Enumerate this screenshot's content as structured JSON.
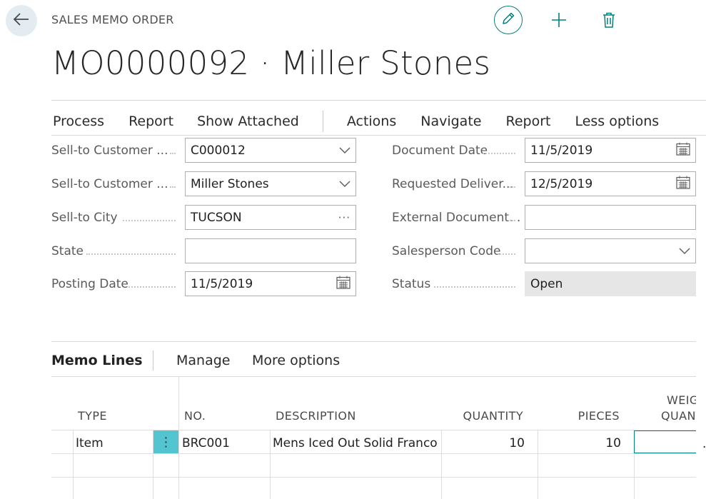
{
  "header": {
    "caption": "SALES MEMO ORDER",
    "title": "MO0000092 · Miller Stones",
    "icons": {
      "back": "arrow-left-icon",
      "edit": "pencil-icon",
      "new": "plus-icon",
      "delete": "trash-icon"
    }
  },
  "actionbar": {
    "items": [
      "Process",
      "Report",
      "Show Attached",
      "Actions",
      "Navigate",
      "Report",
      "Less options"
    ]
  },
  "form": {
    "left": [
      {
        "label": "Sell-to Customer ...",
        "value": "C000012",
        "control": "dropdown"
      },
      {
        "label": "Sell-to Customer ...",
        "value": "Miller Stones",
        "control": "dropdown"
      },
      {
        "label": "Sell-to City",
        "value": "TUCSON",
        "control": "lookup"
      },
      {
        "label": "State",
        "value": "",
        "control": "text"
      },
      {
        "label": "Posting Date",
        "value": "11/5/2019",
        "control": "date"
      }
    ],
    "right": [
      {
        "label": "Document Date",
        "value": "11/5/2019",
        "control": "date"
      },
      {
        "label": "Requested Deliver...",
        "value": "12/5/2019",
        "control": "date"
      },
      {
        "label": "External Document...",
        "value": "",
        "control": "text"
      },
      {
        "label": "Salesperson Code",
        "value": "",
        "control": "dropdown"
      },
      {
        "label": "Status",
        "value": "Open",
        "control": "readonly"
      }
    ],
    "lookup_glyph": "···"
  },
  "lines": {
    "title": "Memo Lines",
    "menu": [
      "Manage",
      "More options"
    ],
    "columns": {
      "type": "TYPE",
      "no": "NO.",
      "description": "DESCRIPTION",
      "quantity": "QUANTITY",
      "pieces": "PIECES",
      "weight_line1": "WEIG",
      "weight_line2": "QUANT"
    },
    "row_menu_glyph": "⋮",
    "rows": [
      {
        "type": "Item",
        "no": "BRC001",
        "description": "Mens Iced Out Solid Franco ...",
        "quantity": "10",
        "pieces": "10",
        "weight": ""
      }
    ],
    "stray_mark": "."
  },
  "colors": {
    "accent": "#00807a",
    "row_selected": "#52c5d0",
    "readonly_bg": "#e6e6e6",
    "back_bg": "#e3ecf0"
  }
}
